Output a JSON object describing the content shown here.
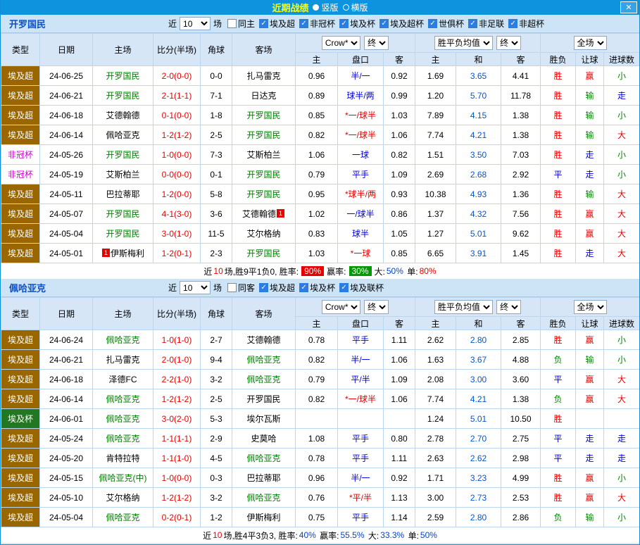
{
  "titlebar": {
    "title": "近期战绩",
    "radio_vertical": "竖版",
    "radio_horizontal": "横版",
    "close_label": "✕"
  },
  "palette": {
    "accent_bar": "#0e93de",
    "win_red": "#e60000",
    "draw_blue": "#0000dd",
    "loss_green": "#008800",
    "focal_green": "#008000",
    "type_league_bg": "#996600",
    "type_cup_bg": "#227722",
    "type_caf_text": "#cc00cc"
  },
  "columns": {
    "type": "类型",
    "date": "日期",
    "home": "主场",
    "score": "比分(半场)",
    "corner": "角球",
    "away": "客场",
    "asian_company": "Crow*",
    "asian_final": "终",
    "euro_company": "胜平负均值",
    "euro_final": "终",
    "scope": "全场",
    "sub_home": "主",
    "sub_handicap": "盘口",
    "sub_away": "客",
    "sub_ehome": "主",
    "sub_draw": "和",
    "sub_eaway": "客",
    "sub_result": "胜负",
    "sub_handicap_result": "让球",
    "sub_goals": "进球数"
  },
  "sections": [
    {
      "team": "开罗国民",
      "filter": {
        "near_label": "近",
        "count": "10",
        "games_label": "场",
        "checkboxes": [
          {
            "label": "同主",
            "checked": false
          },
          {
            "label": "埃及超",
            "checked": true
          },
          {
            "label": "非冠杯",
            "checked": true
          },
          {
            "label": "埃及杯",
            "checked": true
          },
          {
            "label": "埃及超杯",
            "checked": true
          },
          {
            "label": "世俱杯",
            "checked": true
          },
          {
            "label": "非足联",
            "checked": true
          },
          {
            "label": "非超杯",
            "checked": true
          }
        ]
      },
      "rows": [
        {
          "type": "埃及超",
          "date": "24-06-25",
          "home": "开罗国民",
          "home_focal": true,
          "score": "2-0(0-0)",
          "corner": "0-0",
          "away": "扎马雷克",
          "odds": [
            "0.96",
            "半/一",
            "0.92"
          ],
          "euro": [
            "1.69",
            "3.65",
            "4.41"
          ],
          "results": [
            "胜",
            "赢",
            "小"
          ]
        },
        {
          "type": "埃及超",
          "date": "24-06-21",
          "home": "开罗国民",
          "home_focal": true,
          "score": "2-1(1-1)",
          "corner": "7-1",
          "away": "日达克",
          "odds": [
            "0.89",
            "球半/两",
            "0.99"
          ],
          "euro": [
            "1.20",
            "5.70",
            "11.78"
          ],
          "results": [
            "胜",
            "输",
            "走"
          ]
        },
        {
          "type": "埃及超",
          "date": "24-06-18",
          "home": "艾德翰德",
          "score": "0-1(0-0)",
          "corner": "1-8",
          "away": "开罗国民",
          "away_focal": true,
          "odds": [
            "0.85",
            "*一/球半",
            "1.03"
          ],
          "euro": [
            "7.89",
            "4.15",
            "1.38"
          ],
          "results": [
            "胜",
            "输",
            "小"
          ]
        },
        {
          "type": "埃及超",
          "date": "24-06-14",
          "home": "佩哈亚克",
          "score": "1-2(1-2)",
          "corner": "2-5",
          "away": "开罗国民",
          "away_focal": true,
          "odds": [
            "0.82",
            "*一/球半",
            "1.06"
          ],
          "euro": [
            "7.74",
            "4.21",
            "1.38"
          ],
          "results": [
            "胜",
            "输",
            "大"
          ]
        },
        {
          "type": "非冠杯",
          "date": "24-05-26",
          "home": "开罗国民",
          "home_focal": true,
          "score": "1-0(0-0)",
          "corner": "7-3",
          "away": "艾斯柏兰",
          "odds": [
            "1.06",
            "一球",
            "0.82"
          ],
          "euro": [
            "1.51",
            "3.50",
            "7.03"
          ],
          "results": [
            "胜",
            "走",
            "小"
          ]
        },
        {
          "type": "非冠杯",
          "date": "24-05-19",
          "home": "艾斯柏兰",
          "score": "0-0(0-0)",
          "corner": "0-1",
          "away": "开罗国民",
          "away_focal": true,
          "odds": [
            "0.79",
            "平手",
            "1.09"
          ],
          "euro": [
            "2.69",
            "2.68",
            "2.92"
          ],
          "results": [
            "平",
            "走",
            "小"
          ]
        },
        {
          "type": "埃及超",
          "date": "24-05-11",
          "home": "巴拉蒂耶",
          "score": "1-2(0-0)",
          "corner": "5-8",
          "away": "开罗国民",
          "away_focal": true,
          "odds": [
            "0.95",
            "*球半/两",
            "0.93"
          ],
          "euro": [
            "10.38",
            "4.93",
            "1.36"
          ],
          "results": [
            "胜",
            "输",
            "大"
          ]
        },
        {
          "type": "埃及超",
          "date": "24-05-07",
          "home": "开罗国民",
          "home_focal": true,
          "score": "4-1(3-0)",
          "corner": "3-6",
          "away": "艾德翰德",
          "away_card": "1",
          "away_card_pos": "post",
          "odds": [
            "1.02",
            "一/球半",
            "0.86"
          ],
          "euro": [
            "1.37",
            "4.32",
            "7.56"
          ],
          "results": [
            "胜",
            "赢",
            "大"
          ]
        },
        {
          "type": "埃及超",
          "date": "24-05-04",
          "home": "开罗国民",
          "home_focal": true,
          "score": "3-0(1-0)",
          "corner": "11-5",
          "away": "艾尔格纳",
          "odds": [
            "0.83",
            "球半",
            "1.05"
          ],
          "euro": [
            "1.27",
            "5.01",
            "9.62"
          ],
          "results": [
            "胜",
            "赢",
            "大"
          ]
        },
        {
          "type": "埃及超",
          "date": "24-05-01",
          "home": "伊斯梅利",
          "home_card": "1",
          "home_card_pos": "pre",
          "score": "1-2(0-1)",
          "corner": "2-3",
          "away": "开罗国民",
          "away_focal": true,
          "odds": [
            "1.03",
            "*一球",
            "0.85"
          ],
          "euro": [
            "6.65",
            "3.91",
            "1.45"
          ],
          "results": [
            "胜",
            "走",
            "大"
          ]
        }
      ],
      "footer": [
        {
          "text": "近",
          "style": "plain"
        },
        {
          "text": "10",
          "style": "red"
        },
        {
          "text": "场,胜9平1负0, 胜率:",
          "style": "plain"
        },
        {
          "text": "90%",
          "style": "badge-red"
        },
        {
          "text": "赢率:",
          "style": "plain"
        },
        {
          "text": "30%",
          "style": "badge-green"
        },
        {
          "text": "大:",
          "style": "plain"
        },
        {
          "text": "50%",
          "style": "blue"
        },
        {
          "text": " 单:",
          "style": "plain"
        },
        {
          "text": "80%",
          "style": "red"
        }
      ]
    },
    {
      "team": "佩哈亚克",
      "filter": {
        "near_label": "近",
        "count": "10",
        "games_label": "场",
        "checkboxes": [
          {
            "label": "同客",
            "checked": false
          },
          {
            "label": "埃及超",
            "checked": true
          },
          {
            "label": "埃及杯",
            "checked": true
          },
          {
            "label": "埃及联杯",
            "checked": true
          }
        ]
      },
      "rows": [
        {
          "type": "埃及超",
          "date": "24-06-24",
          "home": "佩哈亚克",
          "home_focal": true,
          "score": "1-0(1-0)",
          "corner": "2-7",
          "away": "艾德翰德",
          "odds": [
            "0.78",
            "平手",
            "1.11"
          ],
          "euro": [
            "2.62",
            "2.80",
            "2.85"
          ],
          "results": [
            "胜",
            "赢",
            "小"
          ]
        },
        {
          "type": "埃及超",
          "date": "24-06-21",
          "home": "扎马雷克",
          "score": "2-0(1-0)",
          "corner": "9-4",
          "away": "佩哈亚克",
          "away_focal": true,
          "odds": [
            "0.82",
            "半/一",
            "1.06"
          ],
          "euro": [
            "1.63",
            "3.67",
            "4.88"
          ],
          "results": [
            "负",
            "输",
            "小"
          ]
        },
        {
          "type": "埃及超",
          "date": "24-06-18",
          "home": "泽德FC",
          "score": "2-2(1-0)",
          "corner": "3-2",
          "away": "佩哈亚克",
          "away_focal": true,
          "odds": [
            "0.79",
            "平/半",
            "1.09"
          ],
          "euro": [
            "2.08",
            "3.00",
            "3.60"
          ],
          "results": [
            "平",
            "赢",
            "大"
          ]
        },
        {
          "type": "埃及超",
          "date": "24-06-14",
          "home": "佩哈亚克",
          "home_focal": true,
          "score": "1-2(1-2)",
          "corner": "2-5",
          "away": "开罗国民",
          "odds": [
            "0.82",
            "*一/球半",
            "1.06"
          ],
          "euro": [
            "7.74",
            "4.21",
            "1.38"
          ],
          "results": [
            "负",
            "赢",
            "大"
          ]
        },
        {
          "type": "埃及杯",
          "date": "24-06-01",
          "home": "佩哈亚克",
          "home_focal": true,
          "score": "3-0(2-0)",
          "corner": "5-3",
          "away": "埃尔瓦斯",
          "odds": [
            "",
            "",
            ""
          ],
          "euro": [
            "1.24",
            "5.01",
            "10.50"
          ],
          "results": [
            "胜",
            "",
            ""
          ]
        },
        {
          "type": "埃及超",
          "date": "24-05-24",
          "home": "佩哈亚克",
          "home_focal": true,
          "score": "1-1(1-1)",
          "corner": "2-9",
          "away": "史莫哈",
          "odds": [
            "1.08",
            "平手",
            "0.80"
          ],
          "euro": [
            "2.78",
            "2.70",
            "2.75"
          ],
          "results": [
            "平",
            "走",
            "走"
          ]
        },
        {
          "type": "埃及超",
          "date": "24-05-20",
          "home": "肯特拉特",
          "score": "1-1(1-0)",
          "corner": "4-5",
          "away": "佩哈亚克",
          "away_focal": true,
          "odds": [
            "0.78",
            "平手",
            "1.11"
          ],
          "euro": [
            "2.63",
            "2.62",
            "2.98"
          ],
          "results": [
            "平",
            "走",
            "走"
          ]
        },
        {
          "type": "埃及超",
          "date": "24-05-15",
          "home": "佩哈亚克(中)",
          "home_focal": true,
          "score": "1-0(0-0)",
          "corner": "0-3",
          "away": "巴拉蒂耶",
          "odds": [
            "0.96",
            "半/一",
            "0.92"
          ],
          "euro": [
            "1.71",
            "3.23",
            "4.99"
          ],
          "results": [
            "胜",
            "赢",
            "小"
          ]
        },
        {
          "type": "埃及超",
          "date": "24-05-10",
          "home": "艾尔格纳",
          "score": "1-2(1-2)",
          "corner": "3-2",
          "away": "佩哈亚克",
          "away_focal": true,
          "odds": [
            "0.76",
            "*平/半",
            "1.13"
          ],
          "euro": [
            "3.00",
            "2.73",
            "2.53"
          ],
          "results": [
            "胜",
            "赢",
            "大"
          ]
        },
        {
          "type": "埃及超",
          "date": "24-05-04",
          "home": "佩哈亚克",
          "home_focal": true,
          "score": "0-2(0-1)",
          "corner": "1-2",
          "away": "伊斯梅利",
          "odds": [
            "0.75",
            "平手",
            "1.14"
          ],
          "euro": [
            "2.59",
            "2.80",
            "2.86"
          ],
          "results": [
            "负",
            "输",
            "小"
          ]
        }
      ],
      "footer": [
        {
          "text": "近",
          "style": "plain"
        },
        {
          "text": "10",
          "style": "red"
        },
        {
          "text": "场,胜4平3负3, 胜率:",
          "style": "plain"
        },
        {
          "text": "40%",
          "style": "blue"
        },
        {
          "text": " 赢率:",
          "style": "plain"
        },
        {
          "text": "55.5%",
          "style": "blue"
        },
        {
          "text": " 大:",
          "style": "plain"
        },
        {
          "text": "33.3%",
          "style": "blue"
        },
        {
          "text": " 单:",
          "style": "plain"
        },
        {
          "text": "50%",
          "style": "blue"
        }
      ]
    }
  ]
}
